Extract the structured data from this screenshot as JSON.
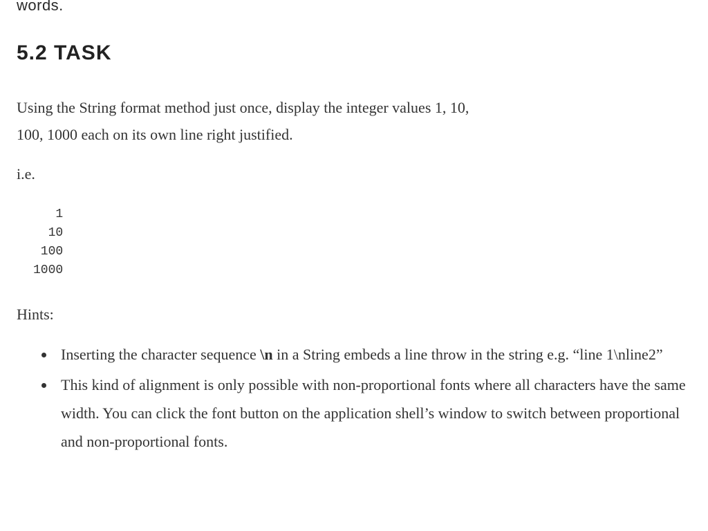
{
  "fragment_top": "words.",
  "heading": "5.2 TASK",
  "intro_line1": "Using the String format method just once, display the integer values 1, 10,",
  "intro_line2": "100, 1000 each on its own line right justified.",
  "ie_label": "i.e.",
  "code_output": "   1\n  10\n 100\n1000",
  "hints_label": "Hints:",
  "hints": [
    {
      "pre": "Inserting the character sequence ",
      "bold": "\\n",
      "post": " in a String embeds a line throw in the string e.g. “line 1\\nline2”"
    },
    {
      "text": "This kind of alignment is only possible with non-proportional fonts where all characters have the same width. You can click the font button on the application shell’s window to switch between proportional and non-proportional fonts."
    }
  ]
}
